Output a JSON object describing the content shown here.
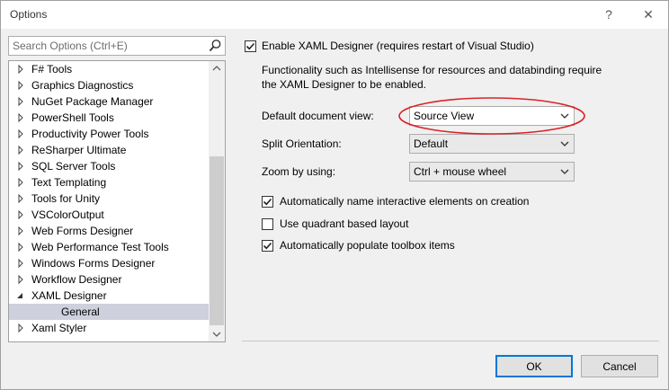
{
  "window": {
    "title": "Options",
    "help_glyph": "?",
    "close_glyph": "✕"
  },
  "search": {
    "placeholder": "Search Options (Ctrl+E)",
    "icon": "search-icon"
  },
  "tree": {
    "items": [
      {
        "label": "F# Tools",
        "state": "collapsed"
      },
      {
        "label": "Graphics Diagnostics",
        "state": "collapsed"
      },
      {
        "label": "NuGet Package Manager",
        "state": "collapsed"
      },
      {
        "label": "PowerShell Tools",
        "state": "collapsed"
      },
      {
        "label": "Productivity Power Tools",
        "state": "collapsed"
      },
      {
        "label": "ReSharper Ultimate",
        "state": "collapsed"
      },
      {
        "label": "SQL Server Tools",
        "state": "collapsed"
      },
      {
        "label": "Text Templating",
        "state": "collapsed"
      },
      {
        "label": "Tools for Unity",
        "state": "collapsed"
      },
      {
        "label": "VSColorOutput",
        "state": "collapsed"
      },
      {
        "label": "Web Forms Designer",
        "state": "collapsed"
      },
      {
        "label": "Web Performance Test Tools",
        "state": "collapsed"
      },
      {
        "label": "Windows Forms Designer",
        "state": "collapsed"
      },
      {
        "label": "Workflow Designer",
        "state": "collapsed"
      },
      {
        "label": "XAML Designer",
        "state": "expanded"
      },
      {
        "label": "General",
        "state": "child-selected"
      },
      {
        "label": "Xaml Styler",
        "state": "collapsed"
      }
    ]
  },
  "settings": {
    "enable_xaml_designer": {
      "label": "Enable XAML Designer (requires restart of Visual Studio)",
      "checked": true
    },
    "description_line1": "Functionality such as Intellisense for resources and databinding require",
    "description_line2": "the XAML Designer to be enabled.",
    "default_view": {
      "label": "Default document view:",
      "value": "Source View"
    },
    "split_orientation": {
      "label": "Split Orientation:",
      "value": "Default"
    },
    "zoom_by": {
      "label": "Zoom by using:",
      "value": "Ctrl + mouse wheel"
    },
    "auto_name": {
      "label": "Automatically name interactive elements on creation",
      "checked": true
    },
    "quadrant_layout": {
      "label": "Use quadrant based layout",
      "checked": false
    },
    "auto_toolbox": {
      "label": "Automatically populate toolbox items",
      "checked": true
    }
  },
  "buttons": {
    "ok": "OK",
    "cancel": "Cancel"
  },
  "colors": {
    "selection": "#cfd0dd",
    "highlight_ellipse": "#d9242a",
    "default_button_border": "#0078d7"
  }
}
